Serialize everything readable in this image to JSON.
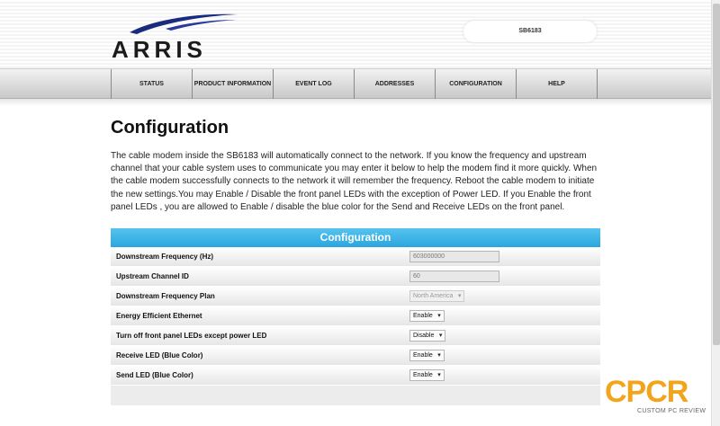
{
  "header": {
    "brand": "ARRIS",
    "model": "SB6183"
  },
  "nav": {
    "items": [
      {
        "label": "STATUS"
      },
      {
        "label": "PRODUCT INFORMATION"
      },
      {
        "label": "EVENT LOG"
      },
      {
        "label": "ADDRESSES"
      },
      {
        "label": "CONFIGURATION"
      },
      {
        "label": "HELP"
      }
    ]
  },
  "page": {
    "title": "Configuration",
    "description": "The cable modem inside the SB6183 will automatically connect to the network. If you know the frequency and upstream channel that your cable system uses to communicate you may enter it below to help the modem find it more quickly. When the cable modem successfully connects to the network it will remember the frequency. Reboot the cable modem to initiate the new settings.You may Enable / Disable the front panel LEDs with the exception of Power LED. If you Enable the front panel LEDs , you are allowed to Enable / disable the blue color for the Send and Receive LEDs on the front panel."
  },
  "config": {
    "header": "Configuration",
    "rows": [
      {
        "label": "Downstream Frequency (Hz)",
        "value": "603000000"
      },
      {
        "label": "Upstream Channel ID",
        "value": "60"
      },
      {
        "label": "Downstream Frequency Plan",
        "value": "North America"
      },
      {
        "label": "Energy Efficient Ethernet",
        "value": "Enable"
      },
      {
        "label": "Turn off front panel LEDs except power LED",
        "value": "Disable"
      },
      {
        "label": "Receive LED (Blue Color)",
        "value": "Enable"
      },
      {
        "label": "Send LED (Blue Color)",
        "value": "Enable"
      }
    ]
  },
  "watermark": {
    "logo": "CPCR",
    "tagline": "CUSTOM PC REVIEW"
  },
  "colors": {
    "accent": "#2aa6de",
    "brand_swoosh": "#1a2a7c",
    "watermark": "#f2a51a"
  }
}
